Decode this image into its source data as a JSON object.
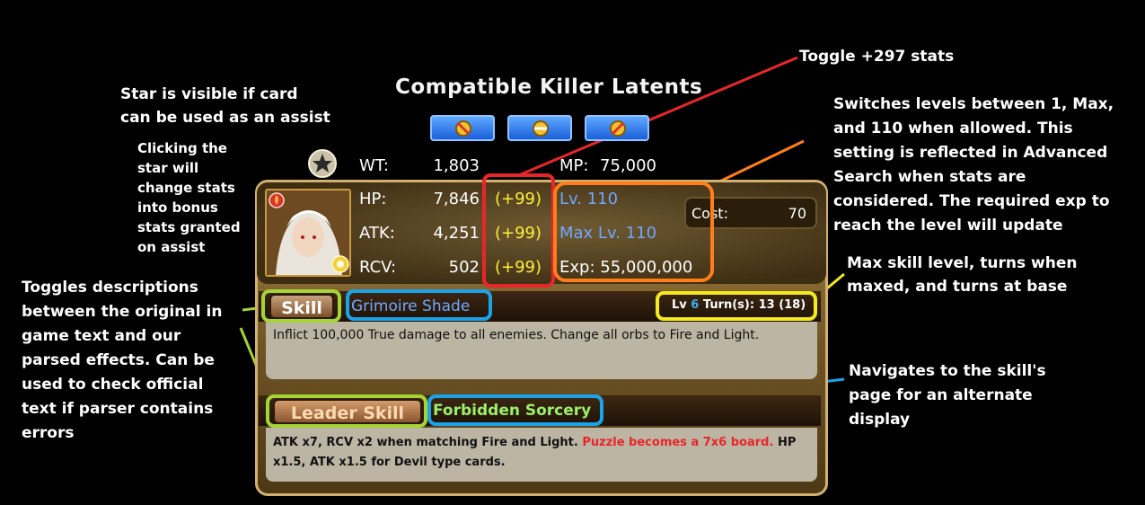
{
  "header": {
    "title": "Compatible Killer Latents"
  },
  "latents": [
    {
      "icon": "killer-latent-badge-icon"
    },
    {
      "icon": "killer-latent-badge-icon"
    },
    {
      "icon": "killer-latent-badge-icon"
    }
  ],
  "annotations": {
    "star": "Star is visible if card\ncan be used as an assist",
    "star_click": "Clicking the\nstar will\nchange stats\ninto bonus\nstats granted\non assist",
    "toggle_stats": "Toggle +297 stats",
    "levels": "Switches levels between 1, Max,\nand 110 when allowed. This\nsetting is reflected in Advanced\nSearch when stats are\nconsidered. The required exp to\nreach the level will update",
    "skill_levels": "Max skill level, turns when\nmaxed, and turns at base",
    "toggle_desc": "Toggles descriptions\nbetween the original in\ngame text and our\nparsed effects. Can be\nused to check official\ntext if parser contains\nerrors",
    "navigate": "Navigates to the skill's\npage for an alternate\ndisplay"
  },
  "stats": {
    "wt_label": "WT:",
    "wt": "1,803",
    "mp_label": "MP:",
    "mp": "75,000",
    "hp_label": "HP:",
    "hp": "7,846",
    "hp_plus": "(+99)",
    "atk_label": "ATK:",
    "atk": "4,251",
    "atk_plus": "(+99)",
    "rcv_label": "RCV:",
    "rcv": "502",
    "rcv_plus": "(+99)",
    "lv": "Lv. 110",
    "max_lv": "Max Lv. 110",
    "exp": "Exp: 55,000,000",
    "cost_label": "Cost:",
    "cost": "70"
  },
  "skill": {
    "tab": "Skill",
    "name": "Grimoire Shade",
    "lv_prefix": "Lv",
    "lv": "6",
    "turns": "Turn(s): 13 (18)",
    "desc": "Inflict 100,000 True damage to all enemies. Change all orbs to Fire and Light."
  },
  "leader": {
    "tab": "Leader Skill",
    "name": "Forbidden Sorcery",
    "desc_a": "ATK x7, RCV x2 when matching Fire and Light.",
    "desc_red": "Puzzle becomes a 7x6 board.",
    "desc_b": "HP x1.5, ATK x1.5 for Devil type cards."
  },
  "colors": {
    "red": "#e8262a",
    "orange": "#ff7d1a",
    "yellow": "#f5ea1c",
    "lime": "#a6d335",
    "blue": "#1aa3e8",
    "cyan": "#3ab3f0",
    "plus": "#ffef38",
    "lv": "#6fa8ff",
    "leader_name": "#9af06a"
  }
}
